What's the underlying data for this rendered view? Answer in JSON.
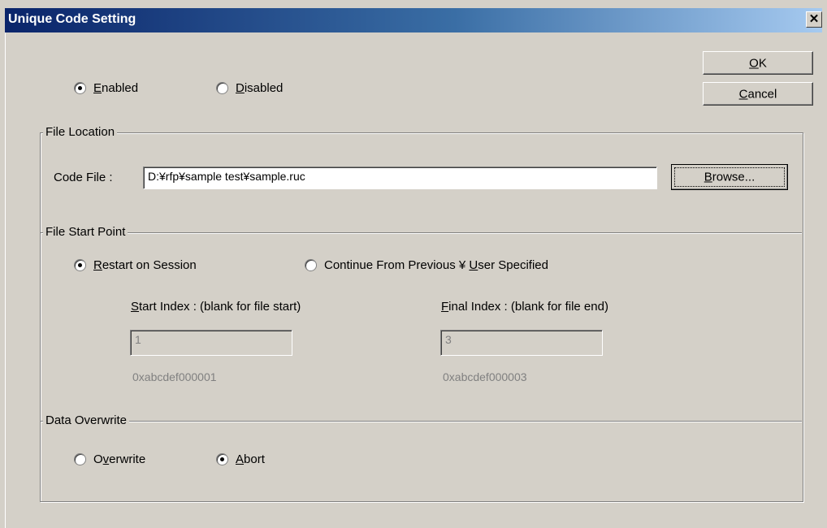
{
  "window": {
    "title": "Unique Code Setting",
    "close_glyph": "✕"
  },
  "buttons": {
    "ok": {
      "pre": "",
      "key": "O",
      "post": "K"
    },
    "cancel": {
      "pre": "",
      "key": "C",
      "post": "ancel"
    },
    "browse": {
      "pre": "",
      "key": "B",
      "post": "rowse..."
    }
  },
  "mode": {
    "enabled": {
      "pre": "",
      "key": "E",
      "post": "nabled",
      "selected": true
    },
    "disabled": {
      "pre": "",
      "key": "D",
      "post": "isabled",
      "selected": false
    }
  },
  "file_location": {
    "legend": "File Location",
    "code_file_label": "Code File :",
    "code_file_value": "D:¥rfp¥sample test¥sample.ruc"
  },
  "file_start_point": {
    "legend": "File Start Point",
    "restart": {
      "pre": "",
      "key": "R",
      "post": "estart on Session",
      "selected": true
    },
    "continue": {
      "pre": "Continue From Previous ¥ ",
      "key": "U",
      "post": "ser Specified",
      "selected": false
    },
    "start_index": {
      "label_pre": "",
      "label_key": "S",
      "label_post": "tart Index : (blank for file start)",
      "value": "1",
      "hex": "0xabcdef000001"
    },
    "final_index": {
      "label_pre": "",
      "label_key": "F",
      "label_post": "inal Index : (blank for file end)",
      "value": "3",
      "hex": "0xabcdef000003"
    }
  },
  "data_overwrite": {
    "legend": "Data Overwrite",
    "overwrite": {
      "pre": "O",
      "key": "v",
      "post": "erwrite",
      "selected": false
    },
    "abort": {
      "pre": "",
      "key": "A",
      "post": "bort",
      "selected": true
    }
  }
}
